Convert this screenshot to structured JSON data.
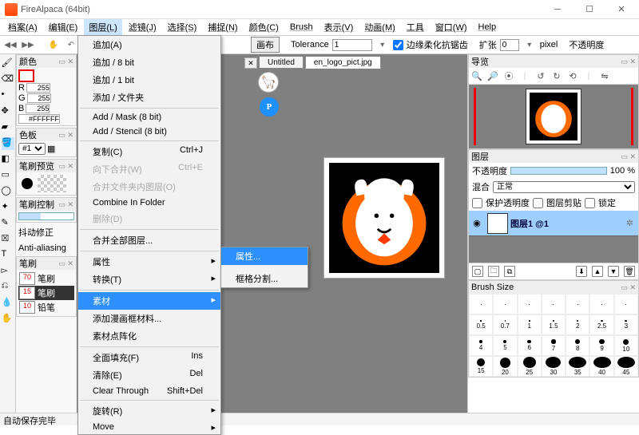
{
  "title": "FireAlpaca (64bit)",
  "menubar": [
    "档案(A)",
    "编辑(E)",
    "图层(L)",
    "滤镜(J)",
    "选择(S)",
    "捕捉(N)",
    "颜色(C)",
    "Brush",
    "表示(V)",
    "动画(M)",
    "工具",
    "窗口(W)",
    "Help"
  ],
  "active_menu_index": 2,
  "toolbar": {
    "canvas_label": "画布",
    "tolerance_label": "Tolerance",
    "tolerance_value": "1",
    "antialias": "边缘柔化抗锯齿",
    "extend": "扩张",
    "extend_val": "0",
    "pixel": "pixel",
    "opacity": "不透明度"
  },
  "tabs": {
    "t1": "Untitled",
    "t2": "en_logo_pict.jpg"
  },
  "panels": {
    "color": "颜色",
    "swatch": "色板",
    "brushprev": "笔刷预览",
    "brushctrl": "笔刷控制",
    "jitter": "抖动修正",
    "aa": "Anti-aliasing",
    "brush": "笔刷",
    "nav": "导览",
    "layer": "图层",
    "brushsize": "Brush Size"
  },
  "rgb": {
    "r": "255",
    "g": "255",
    "b": "255",
    "hex": "#FFFFFF"
  },
  "swatch_sel": "#1",
  "brushes": [
    {
      "w": "70",
      "n": "笔刷"
    },
    {
      "w": "15",
      "n": "笔刷"
    },
    {
      "w": "10",
      "n": "铅笔"
    }
  ],
  "layer_props": {
    "opacity_label": "不透明度",
    "opacity_value": "100 %",
    "blend_label": "混合",
    "blend_value": "正常",
    "protect": "保护透明度",
    "clip": "图层剪贴",
    "lock": "锁定",
    "layer_name": "图层1 @1"
  },
  "brush_sizes": [
    {
      "s": 0.5,
      "l": "0.5"
    },
    {
      "s": 0.7,
      "l": "0.7"
    },
    {
      "s": 1,
      "l": "1"
    },
    {
      "s": 1.5,
      "l": "1.5"
    },
    {
      "s": 2,
      "l": "2"
    },
    {
      "s": 2.5,
      "l": "2.5"
    },
    {
      "s": 3,
      "l": "3"
    },
    {
      "s": 4,
      "l": "4"
    },
    {
      "s": 5,
      "l": "5"
    },
    {
      "s": 6,
      "l": "6"
    },
    {
      "s": 7,
      "l": "7"
    },
    {
      "s": 8,
      "l": "8"
    },
    {
      "s": 9,
      "l": "9"
    },
    {
      "s": 10,
      "l": "10"
    },
    {
      "s": 15,
      "l": "15"
    },
    {
      "s": 20,
      "l": "20"
    },
    {
      "s": 25,
      "l": "25"
    },
    {
      "s": 30,
      "l": "30"
    },
    {
      "s": 35,
      "l": "35"
    },
    {
      "s": 40,
      "l": "40"
    },
    {
      "s": 45,
      "l": "45"
    }
  ],
  "dropdown": [
    {
      "t": "追加(A)"
    },
    {
      "t": "追加 / 8 bit"
    },
    {
      "t": "追加 / 1 bit"
    },
    {
      "t": "添加 / 文件夹"
    },
    {
      "sep": true
    },
    {
      "t": "Add / Mask (8 bit)"
    },
    {
      "t": "Add / Stencil (8 bit)"
    },
    {
      "sep": true
    },
    {
      "t": "复制(C)",
      "k": "Ctrl+J"
    },
    {
      "t": "向下合并(W)",
      "k": "Ctrl+E",
      "d": true
    },
    {
      "t": "合并文件夹内图层(O)",
      "d": true
    },
    {
      "t": "Combine In Folder"
    },
    {
      "t": "删除(D)",
      "d": true
    },
    {
      "sep": true
    },
    {
      "t": "合并全部图层..."
    },
    {
      "sep": true
    },
    {
      "t": "属性",
      "sub": true
    },
    {
      "t": "转换(T)",
      "sub": true
    },
    {
      "sep": true
    },
    {
      "t": "素材",
      "sub": true,
      "hl": true
    },
    {
      "t": "添加漫画框材料..."
    },
    {
      "t": "素材点阵化"
    },
    {
      "sep": true
    },
    {
      "t": "全面填充(F)",
      "k": "Ins"
    },
    {
      "t": "清除(E)",
      "k": "Del"
    },
    {
      "t": "Clear Through",
      "k": "Shift+Del"
    },
    {
      "sep": true
    },
    {
      "t": "旋转(R)",
      "sub": true
    },
    {
      "t": "Move",
      "sub": true
    }
  ],
  "submenu": [
    {
      "t": "属性...",
      "hl": true
    },
    {
      "sep": true
    },
    {
      "t": "框格分割..."
    }
  ],
  "status": "自动保存完毕"
}
